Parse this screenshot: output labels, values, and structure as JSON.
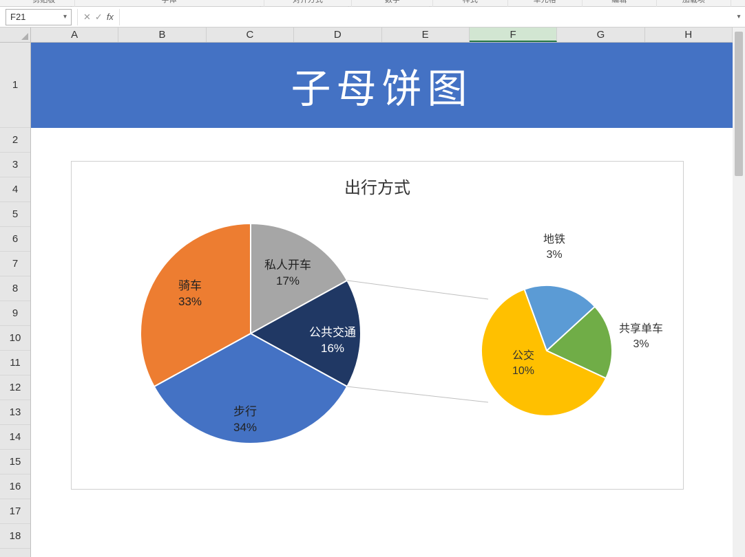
{
  "ribbon": {
    "groups": [
      "剪贴板",
      "字体",
      "对齐方式",
      "数字",
      "样式",
      "单元格",
      "编辑",
      "加载项"
    ]
  },
  "formula_bar": {
    "name_box": "F21",
    "cancel": "✕",
    "enter": "✓",
    "fx": "fx",
    "value": ""
  },
  "columns": [
    "A",
    "B",
    "C",
    "D",
    "E",
    "F",
    "G",
    "H"
  ],
  "selected_col": "F",
  "rows_first_height": 124,
  "rows_rest_height": 36,
  "row_count": 18,
  "sheet": {
    "banner_title": "子母饼图"
  },
  "chart_data": {
    "type": "pie",
    "title": "出行方式",
    "main": {
      "slices": [
        {
          "label": "私人开车",
          "pct": 17,
          "color": "#A6A6A6"
        },
        {
          "label": "公共交通",
          "pct": 16,
          "color": "#203864",
          "breakout": true
        },
        {
          "label": "步行",
          "pct": 34,
          "color": "#4472C4"
        },
        {
          "label": "骑车",
          "pct": 33,
          "color": "#ED7D31"
        }
      ]
    },
    "sub": {
      "parent": "公共交通",
      "slices": [
        {
          "label": "地铁",
          "pct": 3,
          "color": "#5B9BD5"
        },
        {
          "label": "共享单车",
          "pct": 3,
          "color": "#70AD47"
        },
        {
          "label": "公交",
          "pct": 10,
          "color": "#FFC000"
        }
      ]
    }
  }
}
